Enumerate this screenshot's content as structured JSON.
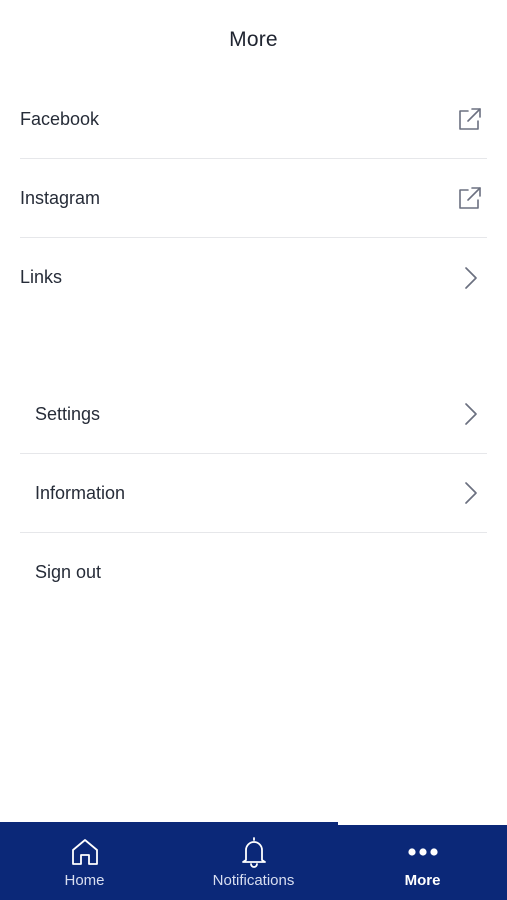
{
  "header": {
    "title": "More"
  },
  "social_links": [
    {
      "label": "Facebook",
      "icon": "external-link-icon"
    },
    {
      "label": "Instagram",
      "icon": "external-link-icon"
    },
    {
      "label": "Links",
      "icon": "chevron-right-icon"
    }
  ],
  "account_items": [
    {
      "label": "Settings",
      "icon": "chevron-right-icon"
    },
    {
      "label": "Information",
      "icon": "chevron-right-icon"
    },
    {
      "label": "Sign out"
    }
  ],
  "tabbar": {
    "background": "#0b2878",
    "tabs": [
      {
        "label": "Home",
        "icon": "home-icon"
      },
      {
        "label": "Notifications",
        "icon": "bell-icon"
      },
      {
        "label": "More",
        "icon": "more-dots-icon",
        "active": true
      }
    ]
  }
}
